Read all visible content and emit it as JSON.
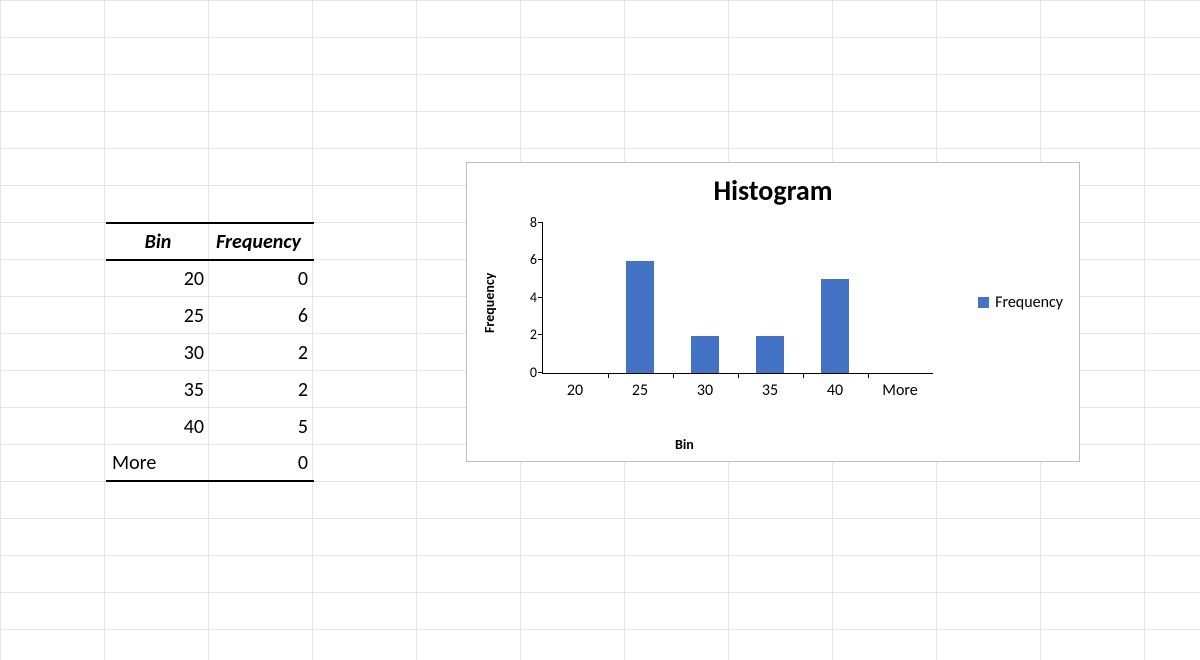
{
  "table": {
    "headers": {
      "bin": "Bin",
      "freq": "Frequency"
    },
    "rows": [
      {
        "bin": "20",
        "freq": "0"
      },
      {
        "bin": "25",
        "freq": "6"
      },
      {
        "bin": "30",
        "freq": "2"
      },
      {
        "bin": "35",
        "freq": "2"
      },
      {
        "bin": "40",
        "freq": "5"
      },
      {
        "bin": "More",
        "freq": "0"
      }
    ]
  },
  "chart_data": {
    "type": "bar",
    "title": "Histogram",
    "xlabel": "Bin",
    "ylabel": "Frequency",
    "categories": [
      "20",
      "25",
      "30",
      "35",
      "40",
      "More"
    ],
    "values": [
      0,
      6,
      2,
      2,
      5,
      0
    ],
    "ylim": [
      0,
      8
    ],
    "yticks": [
      0,
      2,
      4,
      6,
      8
    ],
    "legend": "Frequency",
    "bar_color": "#4472C4"
  }
}
